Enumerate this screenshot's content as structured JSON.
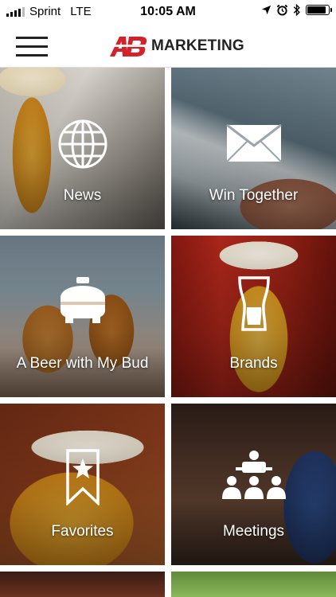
{
  "status_bar": {
    "carrier": "Sprint",
    "network": "LTE",
    "time": "10:05 AM",
    "battery_level": 0.9,
    "icons": [
      "signal-bars-icon",
      "location-arrow-icon",
      "alarm-clock-icon",
      "bluetooth-icon",
      "battery-icon"
    ]
  },
  "header": {
    "logo_mark": "AB",
    "logo_text": "MARKETING",
    "menu_icon": "hamburger-menu-icon",
    "brand_color": "#d2232a"
  },
  "tiles": [
    {
      "label": "News",
      "icon": "globe-icon"
    },
    {
      "label": "Win Together",
      "icon": "envelope-icon"
    },
    {
      "label": "A Beer with My Bud",
      "icon": "keg-icon"
    },
    {
      "label": "Brands",
      "icon": "beer-glass-icon"
    },
    {
      "label": "Favorites",
      "icon": "bookmark-star-icon"
    },
    {
      "label": "Meetings",
      "icon": "presentation-audience-icon"
    }
  ]
}
